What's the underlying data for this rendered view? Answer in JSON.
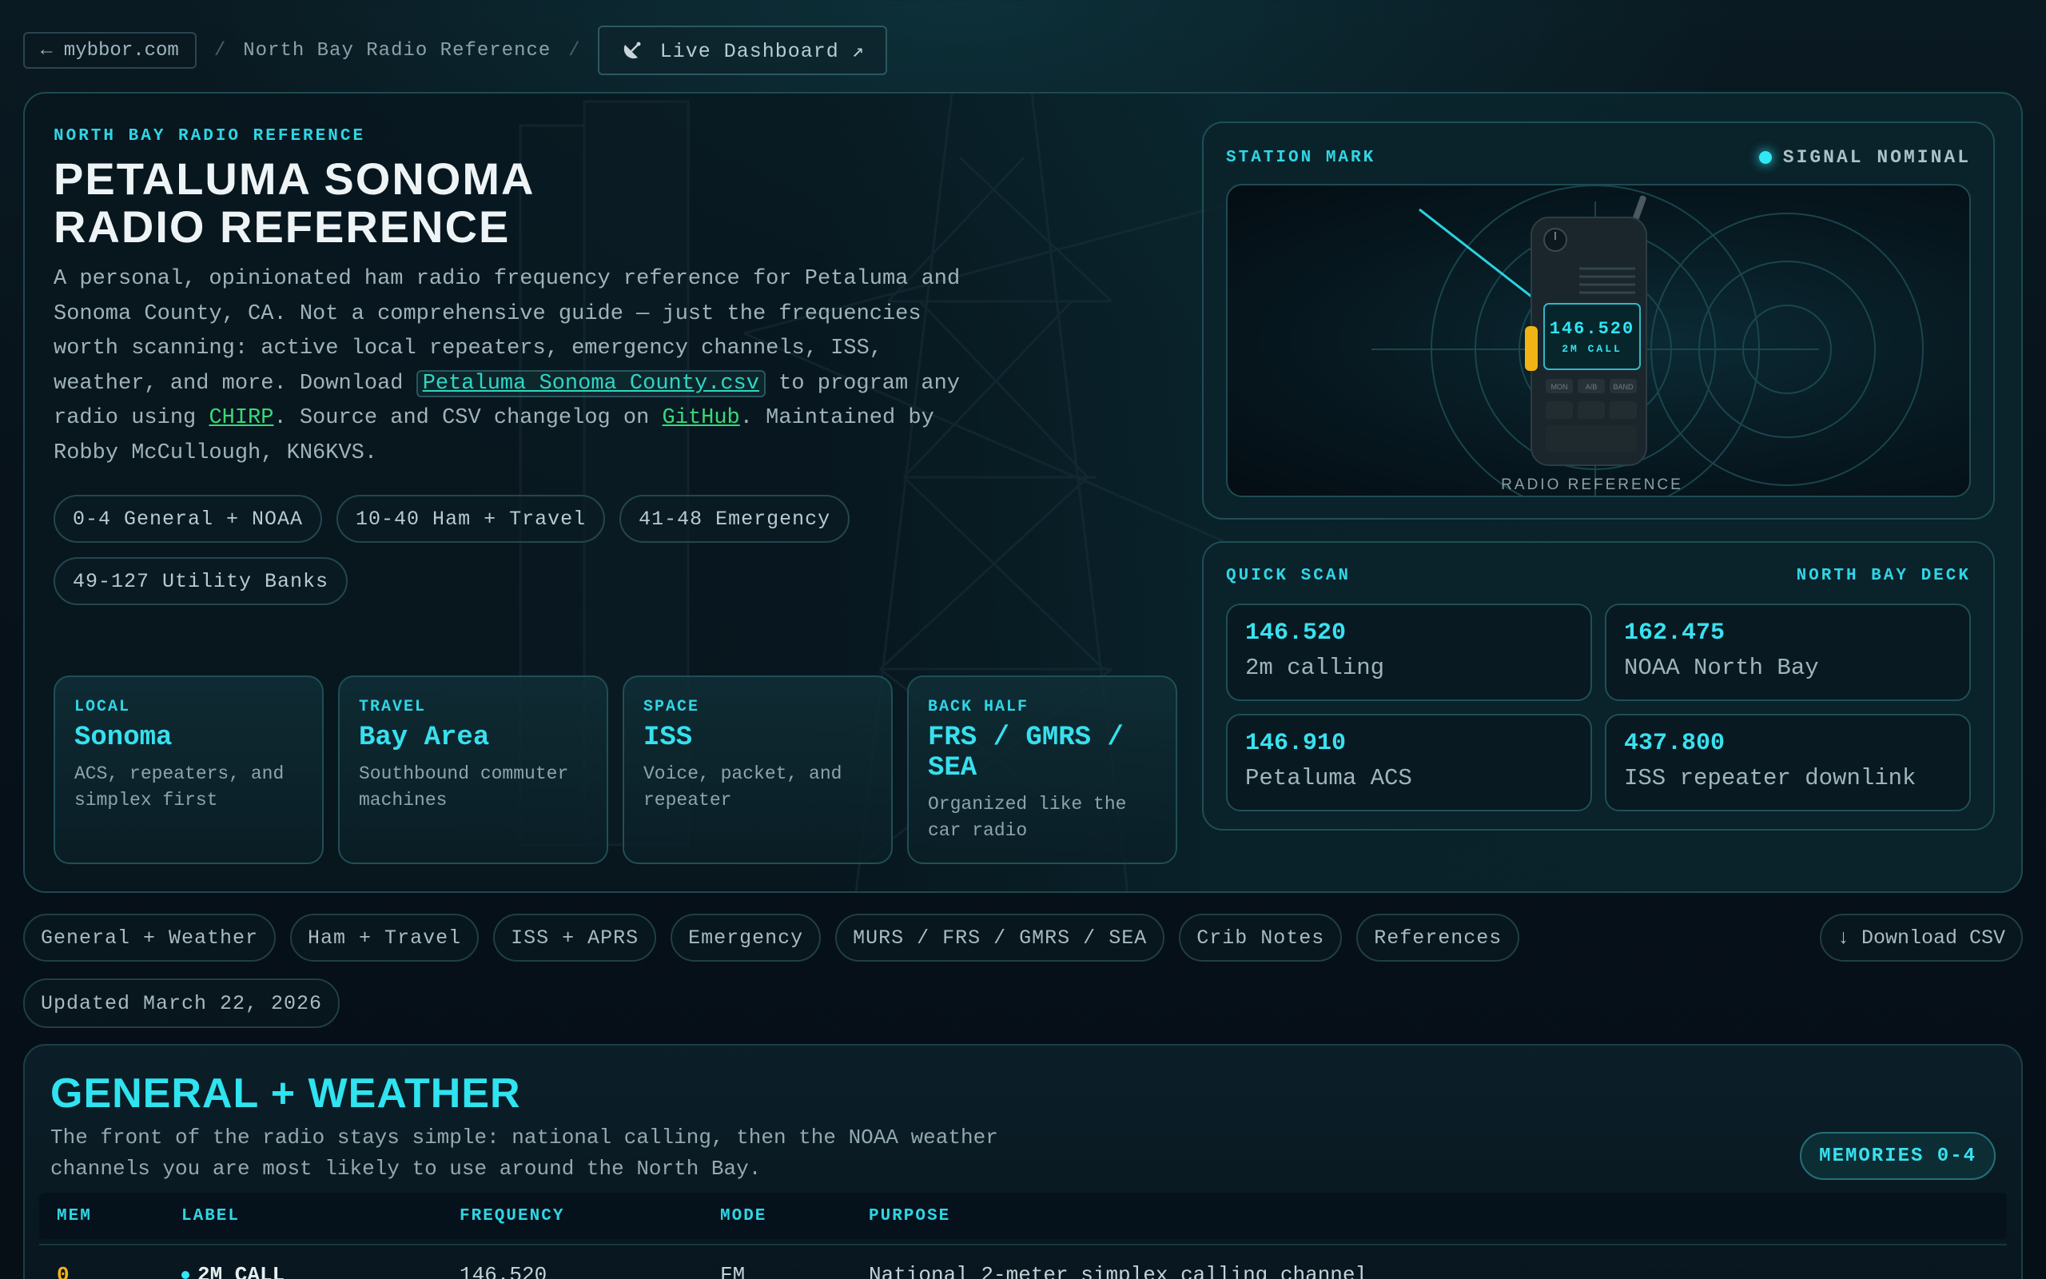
{
  "breadcrumb": {
    "back_label": "← mybbor.com",
    "separator": "/",
    "current": "North Bay Radio Reference",
    "live_label": "Live Dashboard ↗",
    "live_icon": "satellite-dish-icon"
  },
  "hero": {
    "eyebrow": "NORTH BAY RADIO REFERENCE",
    "title": "PETALUMA SONOMA RADIO REFERENCE",
    "desc_1": "A personal, opinionated ham radio frequency reference for Petaluma and Sonoma County, CA. Not a comprehensive guide — just the frequencies worth scanning: active local repeaters, emergency channels, ISS, weather, and more. Download ",
    "desc_link_csv": "Petaluma Sonoma County.csv",
    "desc_2": " to program any radio using ",
    "desc_link_chirp": "CHIRP",
    "desc_3": ". Source and CSV changelog on ",
    "desc_link_github": "GitHub",
    "desc_4": ". Maintained by Robby McCullough, KN6KVS.",
    "pills": [
      "0-4 General + NOAA",
      "10-40 Ham + Travel",
      "41-48 Emergency",
      "49-127 Utility Banks"
    ],
    "cards": [
      {
        "tag": "LOCAL",
        "title": "Sonoma",
        "desc": "ACS, repeaters, and simplex first"
      },
      {
        "tag": "TRAVEL",
        "title": "Bay Area",
        "desc": "Southbound commuter machines"
      },
      {
        "tag": "SPACE",
        "title": "ISS",
        "desc": "Voice, packet, and repeater"
      },
      {
        "tag": "BACK HALF",
        "title": "FRS / GMRS / SEA",
        "desc": "Organized like the car radio"
      }
    ]
  },
  "station": {
    "label": "STATION MARK",
    "status": "SIGNAL NOMINAL",
    "radio_freq": "146.520",
    "radio_sub": "2M CALL",
    "radio_buttons": [
      "MON",
      "A/B",
      "BAND"
    ],
    "caption": "RADIO REFERENCE"
  },
  "quick_scan": {
    "label": "QUICK SCAN",
    "deck": "NORTH BAY DECK",
    "items": [
      {
        "freq": "146.520",
        "label": "2m calling"
      },
      {
        "freq": "162.475",
        "label": "NOAA North Bay"
      },
      {
        "freq": "146.910",
        "label": "Petaluma ACS"
      },
      {
        "freq": "437.800",
        "label": "ISS repeater downlink"
      }
    ]
  },
  "nav": {
    "items": [
      "General + Weather",
      "Ham + Travel",
      "ISS + APRS",
      "Emergency",
      "MURS / FRS / GMRS / SEA",
      "Crib Notes",
      "References"
    ],
    "download": "↓ Download CSV",
    "updated": "Updated March 22, 2026"
  },
  "section": {
    "title": "GENERAL + WEATHER",
    "desc": "The front of the radio stays simple: national calling, then the NOAA weather channels you are most likely to use around the North Bay.",
    "badge": "MEMORIES 0-4",
    "columns": [
      "MEM",
      "LABEL",
      "FREQUENCY",
      "MODE",
      "PURPOSE"
    ],
    "rows": [
      {
        "mem": "0",
        "label": "2M CALL",
        "freq": "146.520",
        "mode": "FM",
        "purpose": "National 2-meter simplex calling channel"
      }
    ]
  },
  "colors": {
    "accent": "#2fd6e6",
    "link": "#2fd6c4",
    "link_green": "#39d97a",
    "mem_number": "#f5b21a"
  }
}
